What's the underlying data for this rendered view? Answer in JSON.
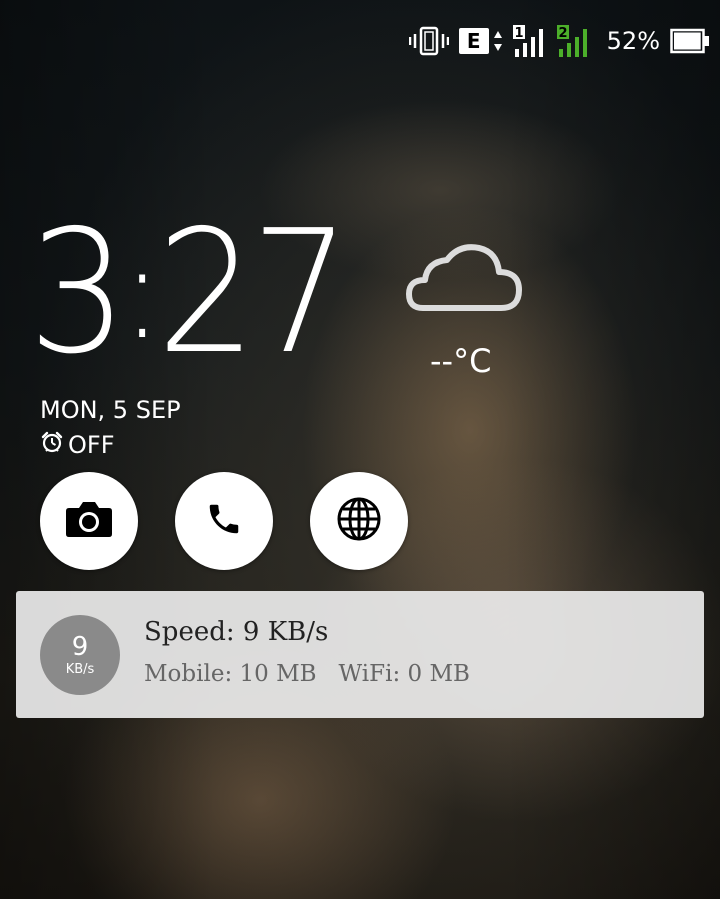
{
  "status_bar": {
    "vibrate_icon": "vibrate-icon",
    "network_type": "E",
    "sim1_label": "1",
    "sim2_label": "2",
    "sim2_color": "#4caf2a",
    "battery_percent": "52%",
    "battery_level": 0.52
  },
  "clock": {
    "hour": "3",
    "separator": ":",
    "minutes": "27"
  },
  "weather": {
    "icon": "cloud-icon",
    "temperature": "--°C"
  },
  "date": "MON, 5 SEP",
  "alarm": {
    "icon": "alarm-clock-icon",
    "label": "OFF"
  },
  "shortcuts": [
    {
      "name": "camera",
      "icon": "camera-icon"
    },
    {
      "name": "phone",
      "icon": "phone-icon"
    },
    {
      "name": "browser",
      "icon": "globe-icon"
    }
  ],
  "notification": {
    "badge_value": "9",
    "badge_unit": "KB/s",
    "title": "Speed: 9 KB/s",
    "mobile": "Mobile: 10 MB",
    "wifi": "WiFi: 0 MB"
  }
}
